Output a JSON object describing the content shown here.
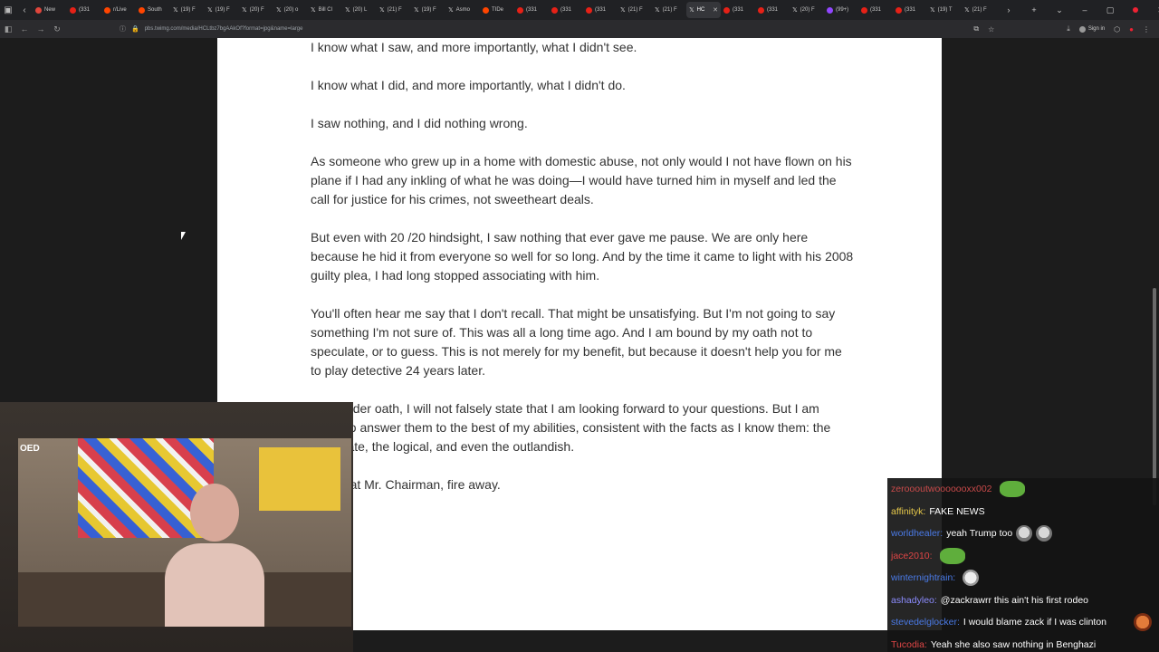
{
  "browser": {
    "tabs": [
      {
        "icon": "gen-icon",
        "label": "New"
      },
      {
        "icon": "youtube-icon",
        "label": "(331"
      },
      {
        "icon": "reddit-icon",
        "label": "r/Live"
      },
      {
        "icon": "reddit-icon",
        "label": "South"
      },
      {
        "icon": "x-icon",
        "label": "(19) F"
      },
      {
        "icon": "x-icon",
        "label": "(19) F"
      },
      {
        "icon": "x-icon",
        "label": "(20) F"
      },
      {
        "icon": "x-icon",
        "label": "(20) o"
      },
      {
        "icon": "x-icon",
        "label": "Bill Cl"
      },
      {
        "icon": "x-icon",
        "label": "(20) L"
      },
      {
        "icon": "x-icon",
        "label": "(21) F"
      },
      {
        "icon": "x-icon",
        "label": "(19) F"
      },
      {
        "icon": "x-icon",
        "label": "Asmo"
      },
      {
        "icon": "reddit-icon",
        "label": "TIDe"
      },
      {
        "icon": "youtube-icon",
        "label": "(331"
      },
      {
        "icon": "youtube-icon",
        "label": "(331"
      },
      {
        "icon": "youtube-icon",
        "label": "(331"
      },
      {
        "icon": "x-icon",
        "label": "(21) F"
      },
      {
        "icon": "x-icon",
        "label": "(21) F"
      },
      {
        "icon": "x-icon",
        "label": "HC",
        "active": true
      },
      {
        "icon": "youtube-icon",
        "label": "(331"
      },
      {
        "icon": "youtube-icon",
        "label": "(331"
      },
      {
        "icon": "x-icon",
        "label": "(20) F"
      },
      {
        "icon": "twitch-icon",
        "label": "(99+)"
      },
      {
        "icon": "youtube-icon",
        "label": "(331"
      },
      {
        "icon": "youtube-icon",
        "label": "(331"
      },
      {
        "icon": "x-icon",
        "label": "(19) T"
      },
      {
        "icon": "x-icon",
        "label": "(21) F"
      }
    ],
    "url": "pbs.twimg.com/media/HCLtbz7bgAAkOf?format=jpg&name=large",
    "signin_label": "Sign in"
  },
  "document": {
    "paragraphs": [
      "I know what I saw, and more importantly, what I didn't see.",
      "I know what I did, and more importantly, what I didn't do.",
      "I saw nothing, and I did nothing wrong.",
      "As someone who grew up in a home with domestic abuse, not only would I not have flown on his plane if I had any inkling of what he was doing—I would have turned him in myself and led the call for justice for his crimes, not sweetheart deals.",
      "But even with 20 /20 hindsight, I saw nothing that ever gave me pause. We are only here because he hid it from everyone so well for so long. And by the time it came to light with his 2008 guilty plea, I had long stopped associating with him.",
      "You'll often hear me say that I don't recall. That might be unsatisfying. But I'm not going to say something I'm not sure of. This was all a long time ago. And I am bound by my oath not to speculate, or to guess. This is not merely for my benefit, but because it doesn't help you for me to play detective 24 years later.",
      "I am under oath, I will not falsely state that I am looking forward to your questions. But I am ready to answer them to the best of my abilities, consistent with the facts as I know them: the legitimate, the logical, and even the outlandish.",
      "With that Mr. Chairman, fire away."
    ]
  },
  "chat": {
    "messages": [
      {
        "user": "zeroooutwooooooxx002",
        "color": "#c94a4a",
        "text": "",
        "emote": "frog"
      },
      {
        "user": "affinityk:",
        "color": "#e6c84a",
        "text": "FAKE NEWS"
      },
      {
        "user": "worldhealer:",
        "color": "#4a7ae6",
        "text": "yeah Trump too",
        "emote": "faces"
      },
      {
        "user": "jace2010:",
        "color": "#e04646",
        "text": "",
        "emote": "frog"
      },
      {
        "user": "winternightrain:",
        "color": "#4a7ae6",
        "text": "",
        "emote": "cat"
      },
      {
        "user": "ashadyleo:",
        "color": "#8c8cff",
        "text": "@zackrawrr this ain't his first rodeo"
      },
      {
        "user": "stevedelglocker:",
        "color": "#4a7ae6",
        "text": "I would blame zack if I was clinton",
        "emote": "mini"
      },
      {
        "user": "Tucodia:",
        "color": "#e04646",
        "text": "Yeah she also saw nothing in Benghazi"
      }
    ]
  },
  "webcam": {
    "badge": "OED"
  }
}
